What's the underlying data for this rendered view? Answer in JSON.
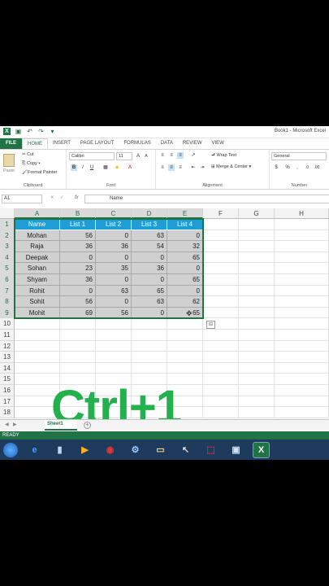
{
  "window": {
    "title": "Book1 - Microsoft Excel"
  },
  "ribbon_tabs": [
    "FILE",
    "HOME",
    "INSERT",
    "PAGE LAYOUT",
    "FORMULAS",
    "DATA",
    "REVIEW",
    "VIEW"
  ],
  "clipboard": {
    "paste": "Paste",
    "cut": "Cut",
    "copy": "Copy",
    "format_painter": "Format Painter",
    "label": "Clipboard"
  },
  "font": {
    "name": "Calibri",
    "size": "11",
    "label": "Font"
  },
  "alignment": {
    "wrap_text": "Wrap Text",
    "merge_center": "Merge & Center",
    "label": "Alignment"
  },
  "number": {
    "format": "General",
    "label": "Number"
  },
  "formula_bar": {
    "name_box": "A1",
    "fx": "fx",
    "content": "Name"
  },
  "columns": [
    "A",
    "B",
    "C",
    "D",
    "E",
    "F",
    "G",
    "H"
  ],
  "rows": [
    "1",
    "2",
    "3",
    "4",
    "5",
    "6",
    "7",
    "8",
    "9",
    "10",
    "11",
    "12",
    "13",
    "14",
    "15",
    "16",
    "17",
    "18"
  ],
  "table": {
    "headers": [
      "Name",
      "List 1",
      "List 2",
      "List 3",
      "List 4"
    ],
    "rows": [
      [
        "Mohan",
        "56",
        "0",
        "63",
        "0"
      ],
      [
        "Raja",
        "36",
        "36",
        "54",
        "32"
      ],
      [
        "Deepak",
        "0",
        "0",
        "0",
        "65"
      ],
      [
        "Sohan",
        "23",
        "35",
        "36",
        "0"
      ],
      [
        "Shyam",
        "36",
        "0",
        "0",
        "65"
      ],
      [
        "Rohit",
        "0",
        "63",
        "65",
        "0"
      ],
      [
        "Sohit",
        "56",
        "0",
        "63",
        "62"
      ],
      [
        "Mohit",
        "69",
        "56",
        "0",
        "65"
      ]
    ]
  },
  "overlay_text": "Ctrl+1",
  "sheet_tabs": {
    "active": "Sheet1"
  },
  "status": "READY"
}
